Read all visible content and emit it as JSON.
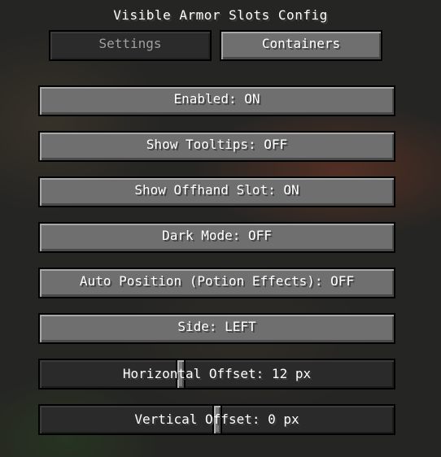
{
  "window": {
    "title": "Visible Armor Slots Config"
  },
  "tabs": {
    "settings": "Settings",
    "containers": "Containers"
  },
  "options": {
    "enabled": "Enabled: ON",
    "show_tooltips": "Show Tooltips: OFF",
    "show_offhand_slot": "Show Offhand Slot: ON",
    "dark_mode": "Dark Mode: OFF",
    "auto_position": "Auto Position (Potion Effects): OFF",
    "side": "Side: LEFT"
  },
  "sliders": {
    "horizontal_offset": {
      "label": "Horizontal Offset: 12 px",
      "value": 12,
      "fraction": 0.395
    },
    "vertical_offset": {
      "label": "Vertical Offset: 0 px",
      "value": 0,
      "fraction": 0.5
    }
  }
}
